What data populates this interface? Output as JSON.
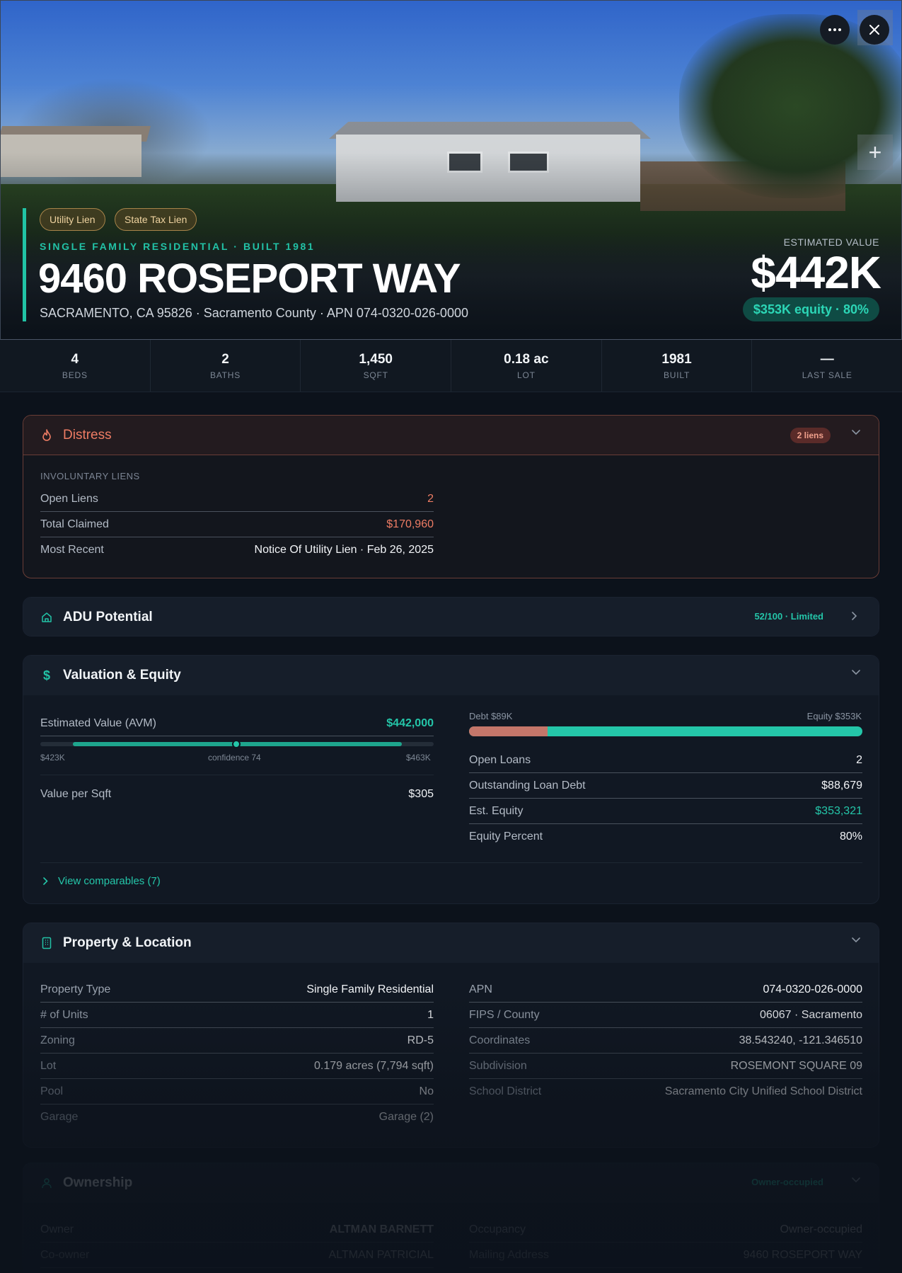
{
  "hero": {
    "tags": [
      "Utility Lien",
      "State Tax Lien"
    ],
    "kicker": "SINGLE FAMILY RESIDENTIAL · BUILT 1981",
    "title": "9460 ROSEPORT WAY",
    "subtitle": "SACRAMENTO, CA 95826 · Sacramento County · APN 074-0320-026-0000",
    "estimated_label": "ESTIMATED VALUE",
    "estimated_value": "$442K",
    "equity_pill": "$353K equity · 80%",
    "more_icon": "more-icon",
    "close_icon": "close-icon",
    "plus_icon": "plus-icon"
  },
  "stats": [
    {
      "value": "4",
      "label": "BEDS"
    },
    {
      "value": "2",
      "label": "BATHS"
    },
    {
      "value": "1,450",
      "label": "SQFT"
    },
    {
      "value": "0.18 ac",
      "label": "LOT"
    },
    {
      "value": "1981",
      "label": "BUILT"
    },
    {
      "value": "—",
      "label": "LAST SALE"
    }
  ],
  "distress": {
    "title": "Distress",
    "badge": "2 liens",
    "caption": "INVOLUNTARY LIENS",
    "rows": [
      {
        "k": "Open Liens",
        "v": "2"
      },
      {
        "k": "Total Claimed",
        "v": "$170,960"
      },
      {
        "k": "Most Recent",
        "v": "Notice Of Utility Lien · Feb 26, 2025"
      }
    ]
  },
  "adu": {
    "title": "ADU Potential",
    "badge": "52/100 · Limited"
  },
  "valuation": {
    "title": "Valuation & Equity",
    "avm_label": "Estimated Value (AVM)",
    "avm_value": "$442,000",
    "range_low": "$423K",
    "range_mid": "confidence 74",
    "range_high": "$463K",
    "confidence": 74,
    "sqft_label": "Value per Sqft",
    "sqft_value": "$305",
    "debt_label": "Debt $89K",
    "equity_label": "Equity $353K",
    "debt_fraction": 0.2,
    "rows": [
      {
        "k": "Open Loans",
        "v": "2"
      },
      {
        "k": "Outstanding Loan Debt",
        "v": "$88,679"
      },
      {
        "k": "Est. Equity",
        "v": "$353,321"
      },
      {
        "k": "Equity Percent",
        "v": "80%"
      }
    ],
    "comparables": "View comparables (7)"
  },
  "property": {
    "title": "Property & Location",
    "left": [
      {
        "k": "Property Type",
        "v": "Single Family Residential"
      },
      {
        "k": "# of Units",
        "v": "1"
      },
      {
        "k": "Zoning",
        "v": "RD-5"
      },
      {
        "k": "Lot",
        "v": "0.179 acres (7,794 sqft)"
      },
      {
        "k": "Pool",
        "v": "No"
      },
      {
        "k": "Garage",
        "v": "Garage (2)"
      }
    ],
    "right": [
      {
        "k": "APN",
        "v": "074-0320-026-0000"
      },
      {
        "k": "FIPS / County",
        "v": "06067 · Sacramento"
      },
      {
        "k": "Coordinates",
        "v": "38.543240, -121.346510"
      },
      {
        "k": "Subdivision",
        "v": "ROSEMONT SQUARE 09"
      },
      {
        "k": "School District",
        "v": "Sacramento City Unified School District"
      }
    ]
  },
  "ownership": {
    "title": "Ownership",
    "badge": "Owner-occupied",
    "left": [
      {
        "k": "Owner",
        "v": "ALTMAN BARNETT"
      },
      {
        "k": "Co-owner",
        "v": "ALTMAN PATRICIAL"
      }
    ],
    "right": [
      {
        "k": "Occupancy",
        "v": "Owner-occupied"
      },
      {
        "k": "Mailing Address",
        "v": "9460 ROSEPORT WAY"
      }
    ]
  },
  "colors": {
    "accent": "#22c2a6",
    "distress": "#ee7c64",
    "debt": "#c4766a"
  }
}
